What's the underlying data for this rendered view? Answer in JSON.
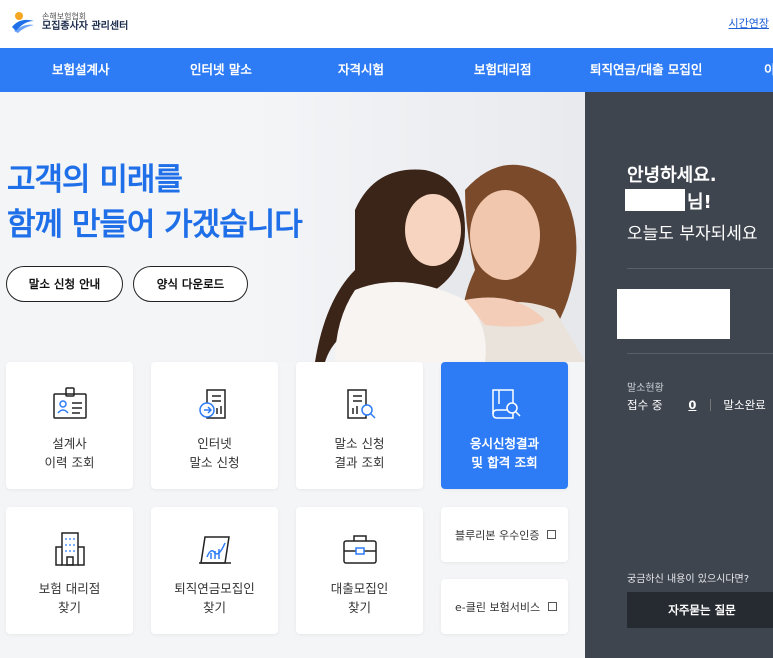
{
  "header": {
    "logo_small": "손해보험협회",
    "logo_main": "모집종사자 관리센터",
    "util_link": "시간연장"
  },
  "nav": {
    "items": [
      {
        "label": "보험설계사"
      },
      {
        "label": "인터넷 말소"
      },
      {
        "label": "자격시험"
      },
      {
        "label": "보험대리점"
      },
      {
        "label": "퇴직연금/대출 모집인"
      },
      {
        "label": "이"
      }
    ]
  },
  "hero": {
    "title_line1": "고객의 미래를",
    "title_line2": "함께 만들어 가겠습니다",
    "btn_guide": "말소 신청 안내",
    "btn_download": "양식 다운로드"
  },
  "cards": {
    "c1": {
      "line1": "설계사",
      "line2": "이력 조회"
    },
    "c2": {
      "line1": "인터넷",
      "line2": "말소 신청"
    },
    "c3": {
      "line1": "말소 신청",
      "line2": "결과 조회"
    },
    "c4": {
      "line1": "응시신청결과",
      "line2": "및 합격 조회"
    },
    "c5": {
      "line1": "보험 대리점",
      "line2": "찾기"
    },
    "c6": {
      "line1": "퇴직연금모집인",
      "line2": "찾기"
    },
    "c7": {
      "line1": "대출모집인",
      "line2": "찾기"
    },
    "c8": {
      "label": "블루리본 우수인증"
    },
    "c9": {
      "label": "e-클린 보험서비스"
    }
  },
  "panel": {
    "greeting": "안녕하세요.",
    "name_suffix": "님!",
    "subtext": "오늘도 부자되세요",
    "status_label": "말소현황",
    "status_receiving": "접수 중",
    "status_count": "0",
    "status_done": "말소완료",
    "faq_question": "궁금하신 내용이 있으시다면?",
    "faq_button": "자주묻는 질문"
  },
  "colors": {
    "accent": "#2d7cf6",
    "panel_bg": "#3f454f",
    "title": "#1f6fe8"
  }
}
